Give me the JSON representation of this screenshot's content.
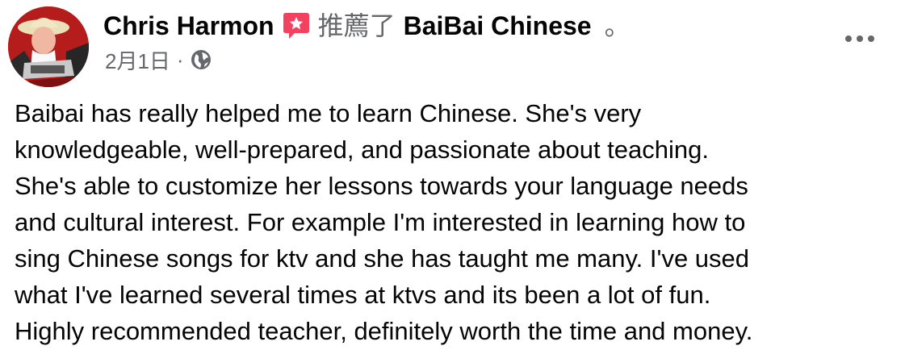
{
  "post": {
    "author": "Chris Harmon",
    "action": "推薦了",
    "page": "BaiBai Chinese",
    "period": "。",
    "date": "2月1日",
    "separator": "·",
    "audience_icon": "globe-icon",
    "recommend_icon": "recommend-star-icon",
    "more_icon": "more-options-icon",
    "body_lines": [
      "Baibai has really helped me to learn Chinese.  She's very",
      "knowledgeable, well-prepared, and passionate about teaching.",
      "She's able to customize her lessons towards your language needs",
      "and cultural interest.  For example I'm interested in learning how to",
      "sing Chinese songs for ktv and she has taught me many.  I've used",
      "what I've learned several times at ktvs and its been a lot of fun.",
      "Highly recommended teacher, definitely worth the time and money."
    ]
  },
  "colors": {
    "text": "#050505",
    "secondary": "#65676b",
    "recommend": "#f3425f",
    "avatar_background": "#b51c1c"
  }
}
